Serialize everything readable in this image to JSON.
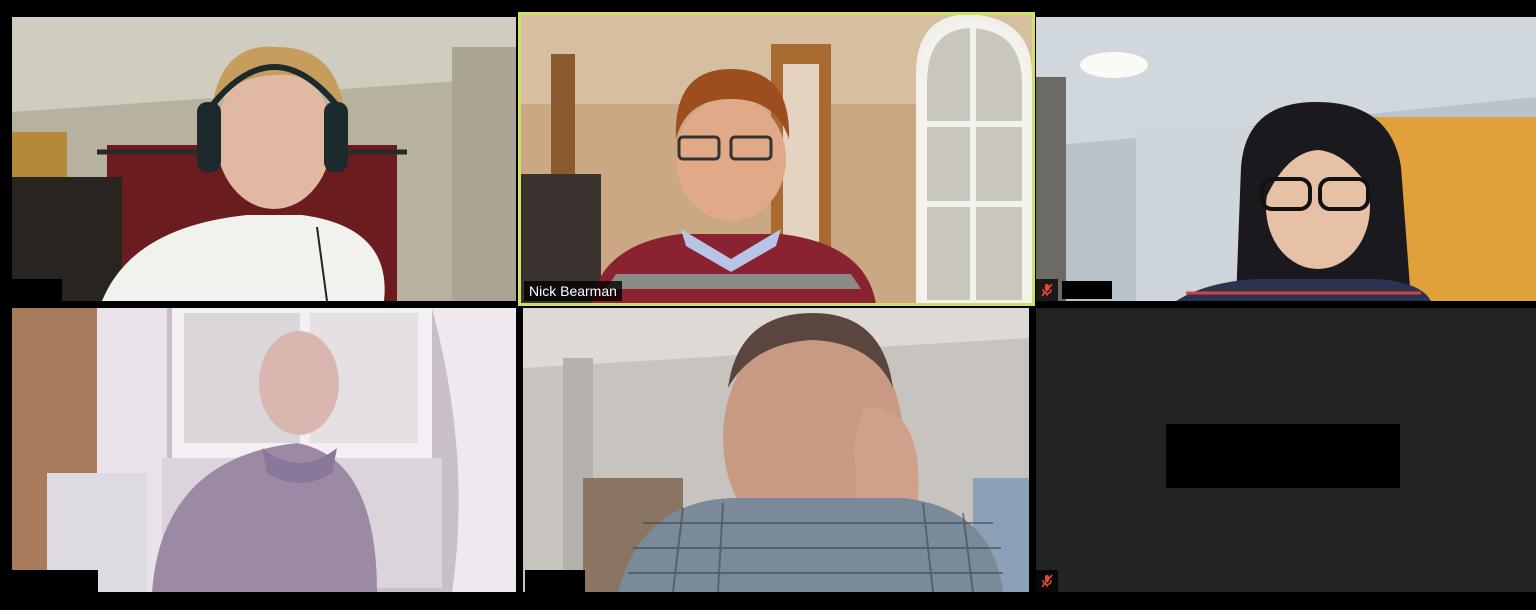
{
  "meeting": {
    "layout": "gallery-view",
    "colors": {
      "background": "#000000",
      "active_speaker_border": "#d2e06a",
      "empty_tile": "#232323",
      "mute_icon": "#e04a3c"
    }
  },
  "participants": [
    {
      "name": "",
      "video": "on",
      "muted": false,
      "active_speaker": false,
      "name_redacted": true
    },
    {
      "name": "Nick Bearman",
      "video": "on",
      "muted": false,
      "active_speaker": true,
      "name_redacted": false
    },
    {
      "name": "",
      "video": "on",
      "muted": true,
      "active_speaker": false,
      "name_redacted": true,
      "icons": [
        "muted-mic-icon"
      ]
    },
    {
      "name": "",
      "video": "on",
      "muted": false,
      "active_speaker": false,
      "name_redacted": true
    },
    {
      "name": "",
      "video": "on",
      "muted": false,
      "active_speaker": false,
      "name_redacted": true
    },
    {
      "name": "",
      "video": "off",
      "muted": true,
      "active_speaker": false,
      "name_redacted": true,
      "icons": [
        "muted-mic-icon"
      ]
    }
  ]
}
